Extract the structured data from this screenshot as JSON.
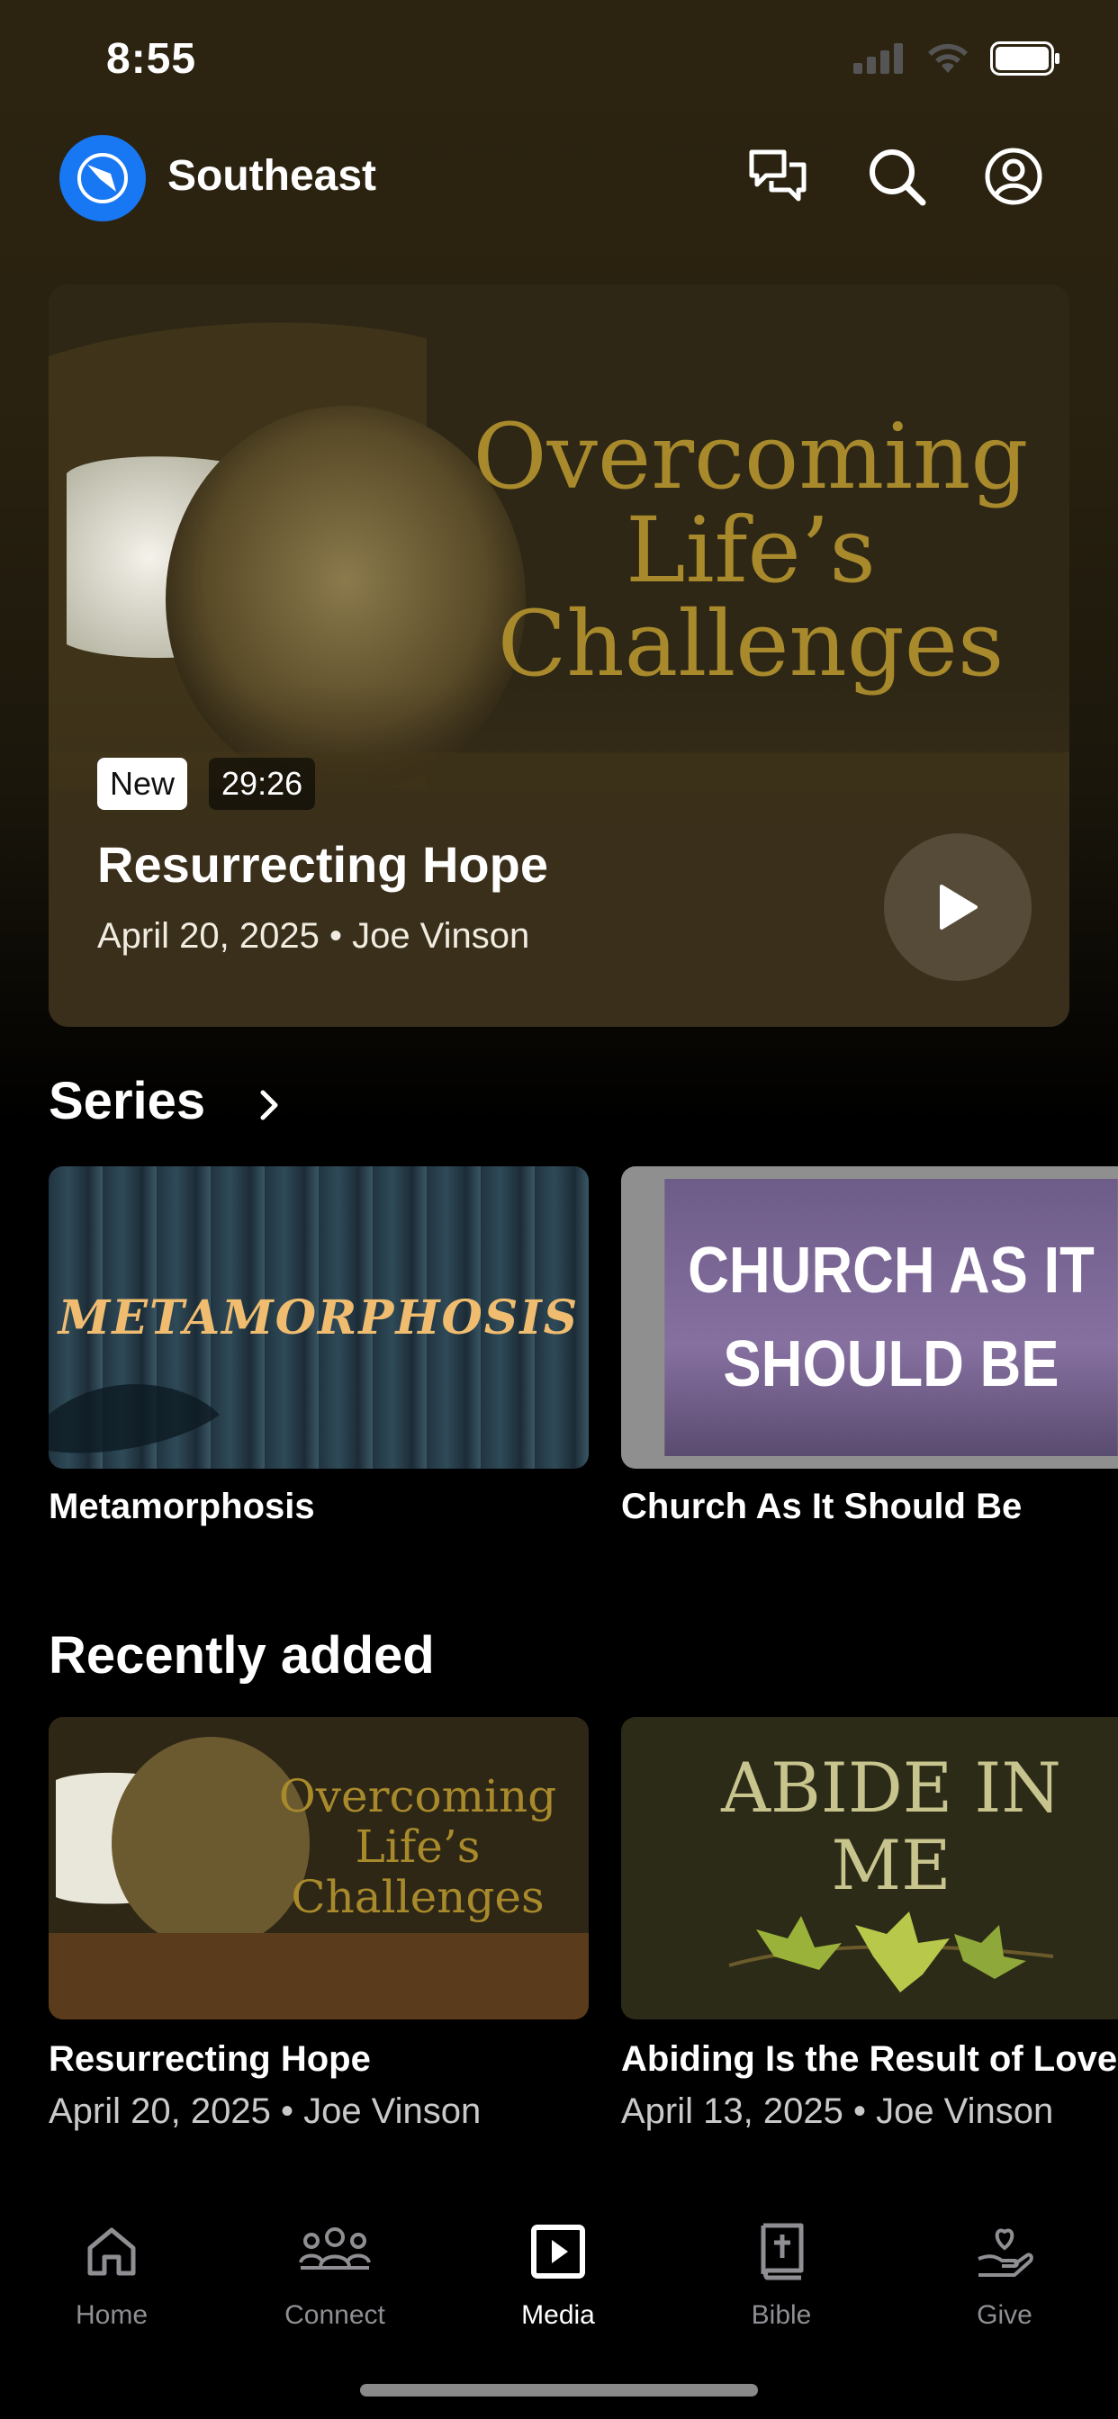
{
  "status": {
    "time": "8:55"
  },
  "header": {
    "campus_name": "Southeast"
  },
  "hero": {
    "art_title": [
      "Overcoming",
      "Life’s",
      "Challenges"
    ],
    "badge_new": "New",
    "duration": "29:26",
    "title": "Resurrecting Hope",
    "meta": "April 20, 2025 • Joe Vinson"
  },
  "series": {
    "heading": "Series",
    "items": [
      {
        "title": "Metamorphosis",
        "art_text": "METAMORPHOSIS"
      },
      {
        "title": "Church As It Should Be",
        "art_text": [
          "CHURCH AS IT",
          "SHOULD BE"
        ]
      }
    ]
  },
  "recent": {
    "heading": "Recently added",
    "items": [
      {
        "title": "Resurrecting Hope",
        "meta": "April 20, 2025 • Joe Vinson",
        "art_text": [
          "Overcoming",
          "Life’s",
          "Challenges"
        ]
      },
      {
        "title": "Abiding Is the Result of Love",
        "meta": "April 13, 2025 • Joe Vinson",
        "art_text": [
          "ABIDE IN",
          "ME"
        ]
      }
    ]
  },
  "tabbar": {
    "items": [
      {
        "label": "Home",
        "icon": "home-icon",
        "active": false
      },
      {
        "label": "Connect",
        "icon": "people-icon",
        "active": false
      },
      {
        "label": "Media",
        "icon": "play-square-icon",
        "active": true
      },
      {
        "label": "Bible",
        "icon": "bible-icon",
        "active": false
      },
      {
        "label": "Give",
        "icon": "give-icon",
        "active": false
      }
    ]
  },
  "colors": {
    "accent": "#1877f2",
    "inactive_tab": "#8e8e93",
    "hero_bg": "#3a2f1a",
    "art_gold": "#a88a2c"
  }
}
